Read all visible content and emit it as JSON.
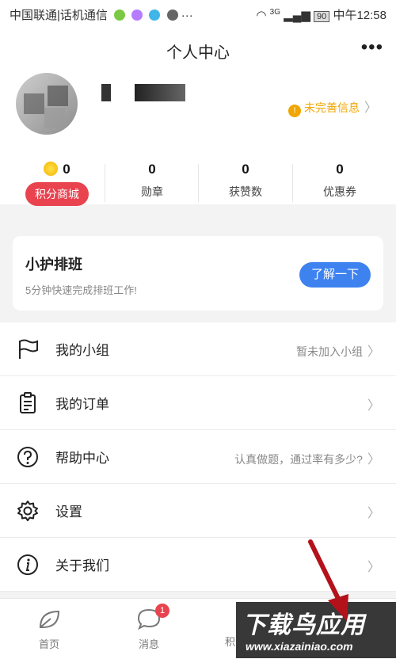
{
  "status_bar": {
    "carrier": "中国联通|话机通信",
    "network": "3G",
    "battery": "90",
    "time": "中午12:58"
  },
  "header": {
    "title": "个人中心",
    "more_icon": "more-icon"
  },
  "profile": {
    "incomplete_label": "未完善信息",
    "stats": [
      {
        "value": "0",
        "label": "积分商城"
      },
      {
        "value": "0",
        "label": "勋章"
      },
      {
        "value": "0",
        "label": "获赞数"
      },
      {
        "value": "0",
        "label": "优惠券"
      }
    ]
  },
  "banner": {
    "title": "小护排班",
    "subtitle": "5分钟快速完成排班工作!",
    "button": "了解一下"
  },
  "menu": [
    {
      "label": "我的小组",
      "note": "暂未加入小组",
      "icon": "flag-icon"
    },
    {
      "label": "我的订单",
      "note": "",
      "icon": "clipboard-icon"
    },
    {
      "label": "帮助中心",
      "note": "认真做题，通过率有多少?",
      "icon": "question-icon"
    },
    {
      "label": "设置",
      "note": "",
      "icon": "gear-icon"
    },
    {
      "label": "关于我们",
      "note": "",
      "icon": "info-icon"
    }
  ],
  "tabbar": {
    "items": [
      {
        "label": "首页",
        "icon": "leaf-icon"
      },
      {
        "label": "消息",
        "icon": "chat-icon",
        "badge": "1"
      },
      {
        "label": "积",
        "icon": "points-icon"
      }
    ]
  },
  "watermark": {
    "text": "下载鸟应用",
    "url": "www.xiazainiao.com"
  },
  "colors": {
    "accent_blue": "#3e82f0",
    "accent_red": "#e8434f",
    "warning": "#f0a500"
  }
}
